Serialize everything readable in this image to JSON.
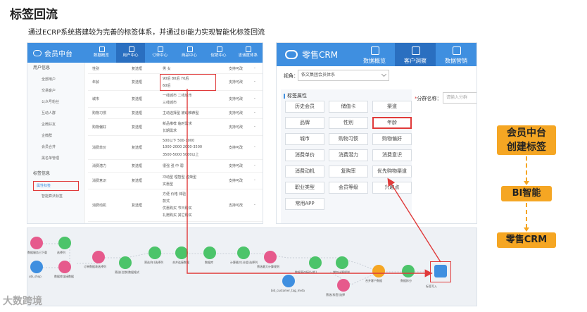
{
  "page": {
    "title": "标签回流",
    "subtitle": "通过ECRP系统搭建较为完善的标签体系，并通过BI能力实现智能化标签回流",
    "watermark": "大数跨境"
  },
  "left_app": {
    "brand": "会员中台",
    "nav": [
      "数据概览",
      "用户中心",
      "订单中心",
      "商品中心",
      "促销中心",
      "忠诚度体系"
    ],
    "side": {
      "header1": "用户信息",
      "items1": [
        "全部用户",
        "交易客户",
        "公众号粉丝",
        "互动人群",
        "企微好友",
        "企微群",
        "会员合并",
        "黑名单管理"
      ],
      "header2": "标签信息",
      "items2": [
        "属性标签",
        "智能算法标签"
      ]
    },
    "rows": [
      {
        "name": "性别",
        "type": "复选框",
        "vals": "男    女",
        "status": "支持可改",
        "dash": "-"
      },
      {
        "name": "年龄",
        "type": "复选框",
        "vals": "90后    80后    70后",
        "vals2": "60后",
        "status": "支持可改",
        "dash": "-"
      },
      {
        "name": "城市",
        "type": "复选框",
        "vals": "一线城市    二线城市",
        "vals2": "三线城市",
        "status": "支持可改",
        "dash": "-"
      },
      {
        "name": "购物习惯",
        "type": "复选框",
        "vals": "主动选择型    被动推荐型",
        "status": "支持可改",
        "dash": "-"
      },
      {
        "name": "购物偏好",
        "type": "复选框",
        "vals": "新品推荐    临时需求",
        "vals2": "长期需求",
        "status": "支持可改",
        "dash": "-"
      },
      {
        "name": "消费单价",
        "type": "复选框",
        "vals": "500以下    500-1000",
        "vals2": "1000-2000    2000-3500",
        "vals3": "3500-5000    5000以上",
        "status": "支持可改",
        "dash": "-"
      },
      {
        "name": "消费潜力",
        "type": "复选框",
        "vals": "很强    强    中    弱",
        "status": "支持可改",
        "dash": "-"
      },
      {
        "name": "消费意识",
        "type": "复选框",
        "vals": "冲动型    理智型    虚荣型",
        "vals2": "实惠型",
        "status": "支持可改",
        "dash": "-"
      },
      {
        "name": "消费动机",
        "type": "复选框",
        "vals": "方便    价格    体验",
        "vals2": "款式",
        "vals3": "优惠购买    节日购买",
        "vals4": "礼赠购买    其它购买",
        "status": "支持可改",
        "dash": "-"
      }
    ]
  },
  "right_app": {
    "brand": "零售CRM",
    "nav": [
      "数据概览",
      "客户洞察",
      "数据营销"
    ],
    "view_label": "视角：",
    "view_value": "依文集团会员体系",
    "tag_header": "标签属性",
    "tags": [
      "历史会员",
      "储值卡",
      "渠道",
      "品牌",
      "性别",
      "年龄",
      "城市",
      "购物习惯",
      "购物偏好",
      "消费单价",
      "消费潜力",
      "消费意识",
      "消费动机",
      "复购率",
      "优先购物渠道",
      "职业类型",
      "会员等级",
      "兴趣点",
      "常用APP"
    ],
    "filter_star": "*",
    "filter_label": "分群名称：",
    "filter_placeholder": "请输入分群"
  },
  "flow": {
    "labels": [
      "数据服务已下载",
      "选择列",
      "订单数据表选择列",
      "筛选(位数)数据格式",
      "筛选(年)选择列",
      "合并连接数据",
      "数据库",
      "计算最大(分组)选择列",
      "筛选最大计算规则",
      "数据表连接(分组)",
      "增加计算规则",
      "合并客户数据",
      "数据拆分",
      "用户标签增量数据",
      "标签写入",
      "ubi_shop",
      "数据库连接数据",
      "bid_customer_tag_meta",
      "筛选(标签)选择",
      "本格标签元数据"
    ]
  },
  "steps": {
    "s1a": "会员中台",
    "s1b": "创建标签",
    "s2": "BI智能",
    "s3": "零售CRM"
  },
  "colors": {
    "blue": "#3f8fe0",
    "red": "#e03a3a",
    "orange": "#f5a623",
    "green": "#4cc46a",
    "pink": "#e65a8c"
  }
}
